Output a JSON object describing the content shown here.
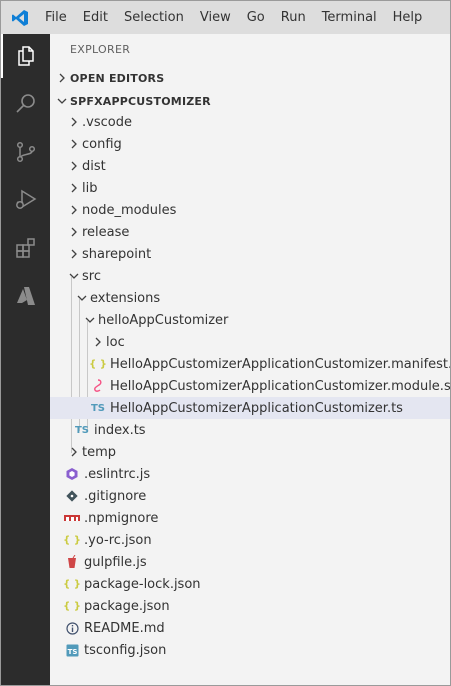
{
  "menu": {
    "items": [
      "File",
      "Edit",
      "Selection",
      "View",
      "Go",
      "Run",
      "Terminal",
      "Help"
    ]
  },
  "activity_bar": {
    "icons": [
      "explorer-icon",
      "search-icon",
      "source-control-icon",
      "run-debug-icon",
      "extensions-icon",
      "azure-icon"
    ],
    "active": "explorer-icon"
  },
  "explorer": {
    "title": "EXPLORER",
    "open_editors_label": "OPEN EDITORS",
    "project_label": "SPFXAPPCUSTOMIZER",
    "tree": [
      {
        "label": ".vscode",
        "kind": "folder",
        "expanded": false
      },
      {
        "label": "config",
        "kind": "folder",
        "expanded": false
      },
      {
        "label": "dist",
        "kind": "folder",
        "expanded": false
      },
      {
        "label": "lib",
        "kind": "folder",
        "expanded": false
      },
      {
        "label": "node_modules",
        "kind": "folder",
        "expanded": false
      },
      {
        "label": "release",
        "kind": "folder",
        "expanded": false
      },
      {
        "label": "sharepoint",
        "kind": "folder",
        "expanded": false
      },
      {
        "label": "src",
        "kind": "folder",
        "expanded": true
      },
      {
        "label": "extensions",
        "kind": "folder",
        "expanded": true
      },
      {
        "label": "helloAppCustomizer",
        "kind": "folder",
        "expanded": true
      },
      {
        "label": "loc",
        "kind": "folder",
        "expanded": false
      },
      {
        "label": "HelloAppCustomizerApplicationCustomizer.manifest.json",
        "kind": "json-icon"
      },
      {
        "label": "HelloAppCustomizerApplicationCustomizer.module.scss",
        "kind": "scss-icon"
      },
      {
        "label": "HelloAppCustomizerApplicationCustomizer.ts",
        "kind": "ts-icon",
        "selected": true
      },
      {
        "label": "index.ts",
        "kind": "ts-icon"
      },
      {
        "label": "temp",
        "kind": "folder",
        "expanded": false
      },
      {
        "label": ".eslintrc.js",
        "kind": "eslint-icon"
      },
      {
        "label": ".gitignore",
        "kind": "git-icon"
      },
      {
        "label": ".npmignore",
        "kind": "npm-icon"
      },
      {
        "label": ".yo-rc.json",
        "kind": "json-icon"
      },
      {
        "label": "gulpfile.js",
        "kind": "gulp-icon"
      },
      {
        "label": "package-lock.json",
        "kind": "json-icon"
      },
      {
        "label": "package.json",
        "kind": "json-icon"
      },
      {
        "label": "README.md",
        "kind": "info-icon"
      },
      {
        "label": "tsconfig.json",
        "kind": "tsconfig-icon"
      }
    ]
  },
  "icon_glyphs": {
    "json": "{ }",
    "ts": "TS"
  },
  "colors": {
    "accent": "#007acc",
    "activity_bar": "#2c2c2c",
    "sidebar": "#f3f3f3",
    "selection": "#e4e6f1",
    "json_icon": "#cbcb41",
    "ts_icon": "#519aba",
    "scss_icon": "#f55385",
    "eslint_icon": "#8a5fcf",
    "npm_icon": "#cb3837",
    "gulp_icon": "#cf4647"
  }
}
